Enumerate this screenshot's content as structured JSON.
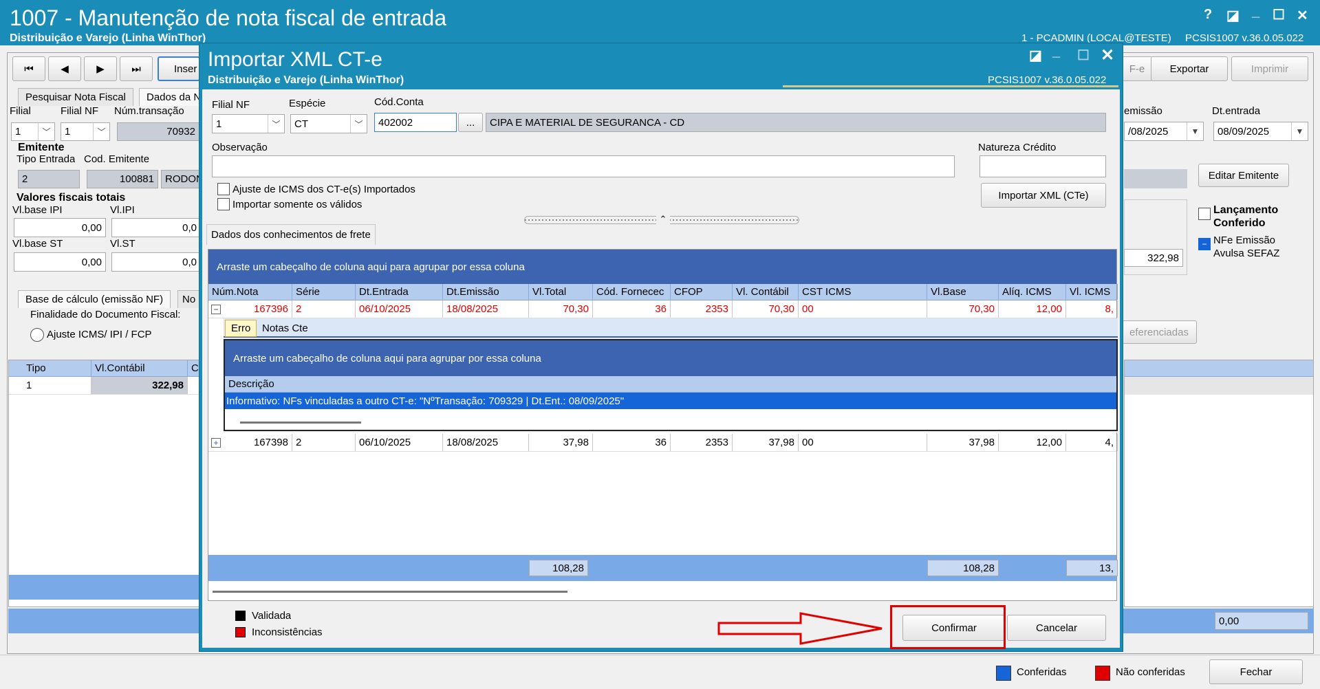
{
  "main_window": {
    "title": "1007 - Manutenção de nota fiscal de entrada",
    "subtitle": "Distribuição e Varejo (Linha WinThor)",
    "user_info": "1 - PCADMIN (LOCAL@TESTE)",
    "version": "PCSIS1007  v.36.0.05.022",
    "controls": [
      "?",
      "◪",
      "_",
      "☐",
      "✕"
    ]
  },
  "toolbar": {
    "first": "⏮",
    "prev": "◀",
    "next": "▶",
    "last": "⏭",
    "insert": "Inser",
    "nfe_partial": "F-e",
    "export": "Exportar",
    "print": "Imprimir"
  },
  "bg": {
    "tabs": [
      "Pesquisar Nota Fiscal",
      "Dados da N"
    ],
    "filial_label": "Filial",
    "filial_value": "1",
    "filial_nf_label": "Filial NF",
    "filial_nf_value": "1",
    "num_transacao_label": "Núm.transação",
    "num_transacao_value": "70932",
    "emitente_header": "Emitente",
    "tipo_entrada_label": "Tipo Entrada",
    "tipo_entrada_value": "2",
    "cod_emitente_label": "Cod. Emitente",
    "cod_emitente_value": "100881",
    "emitente_name": "RODON",
    "valores_header": "Valores fiscais totais",
    "vl_base_ipi_label": "Vl.base IPI",
    "vl_base_ipi_value": "0,00",
    "vl_ipi_label": "Vl.IPI",
    "vl_ipi_value": "0,0",
    "vl_base_st_label": "Vl.base ST",
    "vl_base_st_value": "0,00",
    "vl_st_label": "Vl.ST",
    "vl_st_value": "0,0",
    "lower_tabs": [
      "Base de cálculo (emissão NF)",
      "No"
    ],
    "finalidade_label": "Finalidade do Documento Fiscal:",
    "ajuste_radio": "Ajuste ICMS/ IPI / FCP",
    "grid_cols": [
      "Tipo",
      "Vl.Contábil",
      "CF"
    ],
    "grid_row": {
      "tipo": "1",
      "vl_contabil": "322,98"
    },
    "dt_emissao_label": "emissão",
    "dt_emissao_value": "/08/2025",
    "dt_entrada_label": "Dt.entrada",
    "dt_entrada_value": "08/09/2025",
    "editar_emitente": "Editar Emitente",
    "lancamento_conferido": "Lançamento\nConferido",
    "nfe_emissao": "NFe Emissão\nAvulsa SEFAZ",
    "right_value": "322,98",
    "referenciadas": "eferenciadas",
    "bottom_total": "0,00"
  },
  "status_bar": {
    "conferidas": "Conferidas",
    "nao_conferidas": "Não conferidas",
    "fechar": "Fechar",
    "blue": "#1565d8",
    "red": "#e00000"
  },
  "dialog": {
    "title": "Importar XML CT-e",
    "subtitle": "Distribuição e Varejo (Linha WinThor)",
    "version": "PCSIS1007  v.36.0.05.022",
    "filial_nf_label": "Filial NF",
    "filial_nf_value": "1",
    "especie_label": "Espécie",
    "especie_value": "CT",
    "cod_conta_label": "Cód.Conta",
    "cod_conta_value": "402002",
    "ellipsis": "...",
    "conta_desc": "CIPA E MATERIAL DE SEGURANCA - CD",
    "observacao_label": "Observação",
    "observacao_value": "",
    "natureza_label": "Natureza Crédito",
    "natureza_value": "",
    "ajuste_icms_label": "Ajuste de ICMS dos CT-e(s) Importados",
    "importar_validos_label": "Importar somente os válidos",
    "importar_xml_button": "Importar XML (CTe)",
    "tab_label": "Dados dos conhecimentos de frete",
    "group_hint": "Arraste um cabeçalho de coluna aqui para agrupar por essa coluna",
    "columns": [
      "Núm.Nota",
      "Série",
      "Dt.Entrada",
      "Dt.Emissão",
      "Vl.Total",
      "Cód. Fornecec",
      "CFOP",
      "Vl. Contábil",
      "CST ICMS",
      "Vl.Base",
      "Alíq. ICMS",
      "Vl. ICMS"
    ],
    "rows": [
      {
        "expander": "−",
        "num_nota": "167396",
        "serie": "2",
        "dt_entrada": "06/10/2025",
        "dt_emissao": "18/08/2025",
        "vl_total": "70,30",
        "cod_fornec": "36",
        "cfop": "2353",
        "vl_contabil": "70,30",
        "cst_icms": "00",
        "vl_base": "70,30",
        "aliq_icms": "12,00",
        "vl_icms": "8,"
      },
      {
        "expander": "+",
        "num_nota": "167398",
        "serie": "2",
        "dt_entrada": "06/10/2025",
        "dt_emissao": "18/08/2025",
        "vl_total": "37,98",
        "cod_fornec": "36",
        "cfop": "2353",
        "vl_contabil": "37,98",
        "cst_icms": "00",
        "vl_base": "37,98",
        "aliq_icms": "12,00",
        "vl_icms": "4,"
      }
    ],
    "detail": {
      "tabs": [
        "Erro",
        "Notas Cte"
      ],
      "group_hint": "Arraste um cabeçalho de coluna aqui para agrupar por essa coluna",
      "column": "Descrição",
      "row": "Informativo: NFs vinculadas a outro CT-e: \"NºTransação: 709329 | Dt.Ent.: 08/09/2025\""
    },
    "totals": {
      "vl_total": "108,28",
      "vl_base": "108,28",
      "vl_icms": "13,"
    },
    "legend": {
      "validada": "Validada",
      "inconsistencias": "Inconsistências"
    },
    "confirm_button": "Confirmar",
    "cancel_button": "Cancelar",
    "highlight_color": "#e00000"
  }
}
